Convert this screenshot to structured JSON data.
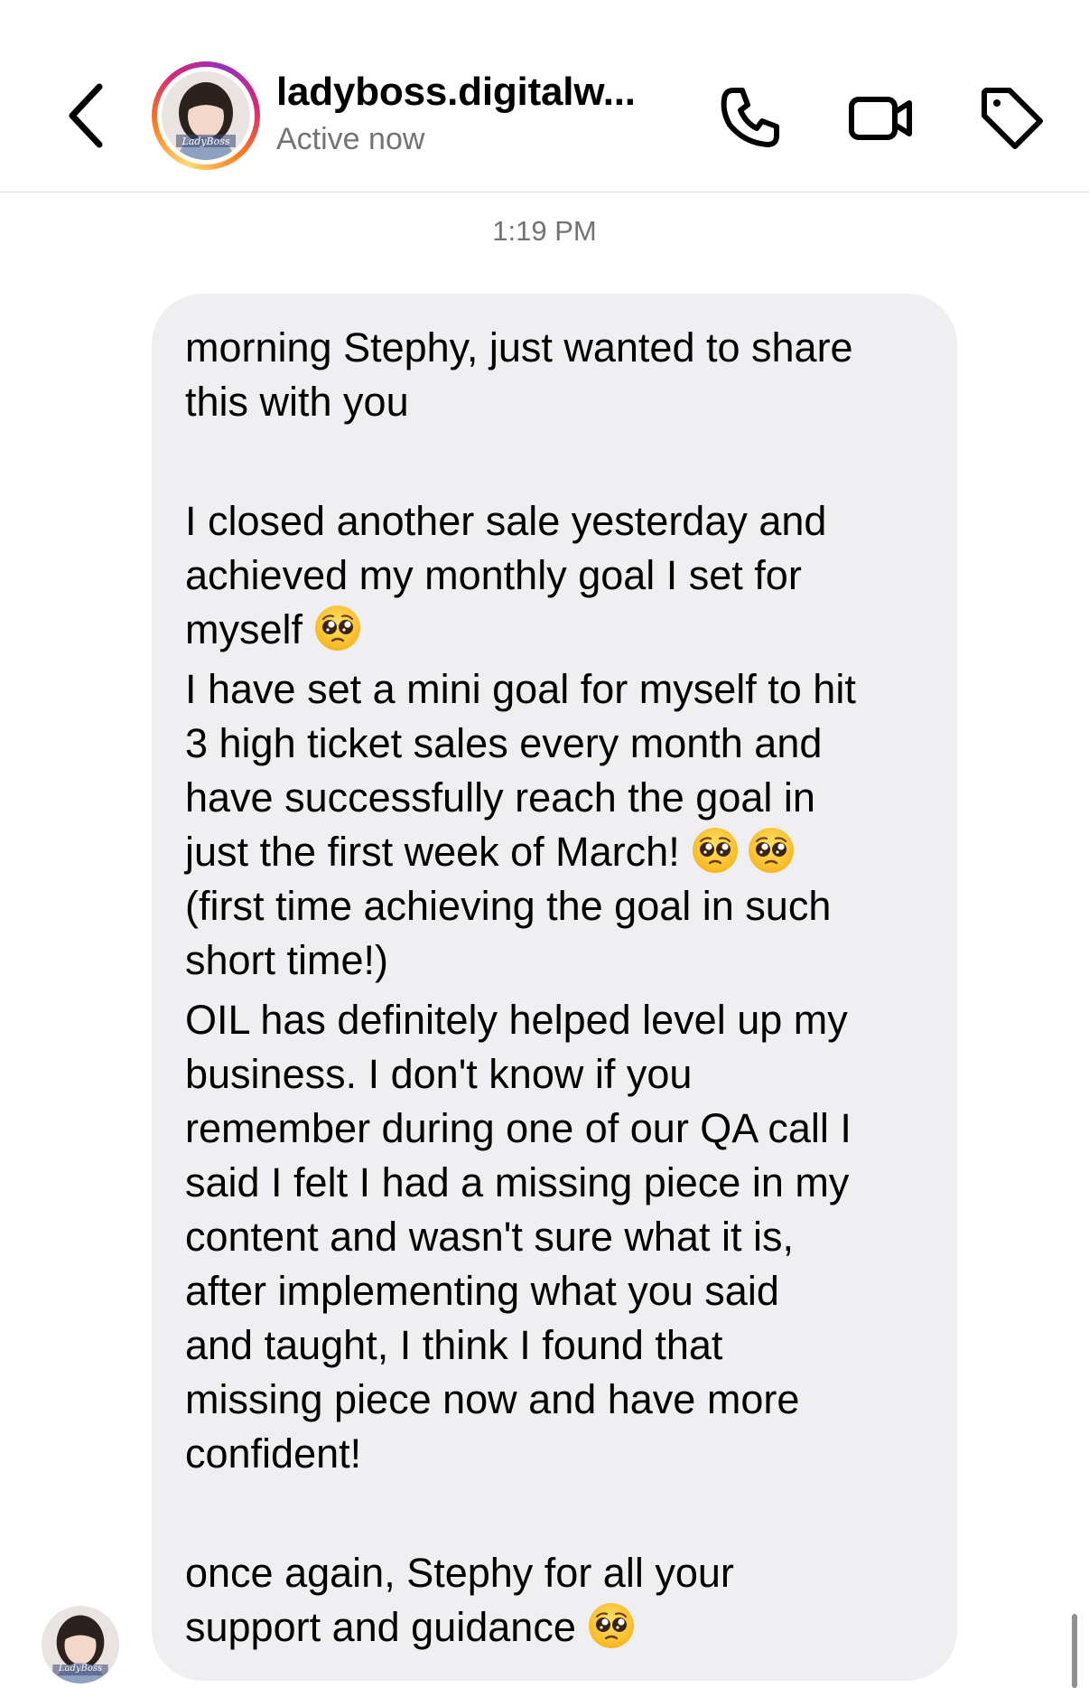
{
  "header": {
    "contact_name": "ladyboss.digitalw...",
    "status": "Active now",
    "avatar_logo_text": "LadyBoss",
    "icons": [
      "back-icon",
      "phone-icon",
      "video-camera-icon",
      "tag-icon"
    ]
  },
  "chat": {
    "timestamp": "1:19 PM",
    "message_lines": [
      "morning Stephy, just wanted to share",
      "this with you",
      "",
      "I closed another sale yesterday and",
      "achieved my monthly goal I set for",
      "myself",
      "I have set a mini goal for myself to hit",
      "3 high ticket sales every month and",
      "have successfully reach the goal in",
      "just the first week of March!",
      "(first time achieving the goal in such",
      "short time!)",
      "OIL has definitely helped level up my",
      "business. I don't know if you",
      "remember during one of our QA call I",
      "said I felt I had a missing piece in my",
      "content and wasn't sure what it is,",
      "after implementing what you said",
      "and taught, I think I found that",
      "missing piece now and have more",
      "confident!",
      "",
      "once again, Stephy for all your",
      "support and guidance"
    ],
    "emoji": "pleading-face"
  },
  "colors": {
    "bubble_bg": "#efeff1",
    "secondary_text": "#737373",
    "story_ring": [
      "#feda75",
      "#fa7e1e",
      "#d62976",
      "#962fbf"
    ]
  }
}
